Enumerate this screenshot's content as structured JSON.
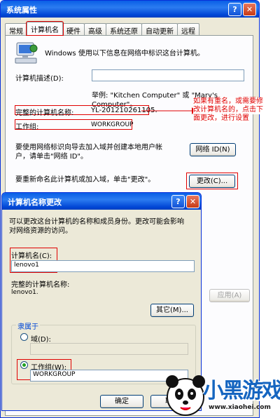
{
  "main_dialog": {
    "title": "系统属性",
    "title_help": "?",
    "title_close": "✕",
    "tabs": [
      "常规",
      "计算机名",
      "硬件",
      "高级",
      "系统还原",
      "自动更新",
      "远程"
    ],
    "intro": "Windows 使用以下信息在网络中标识这台计算机。",
    "desc_label": "计算机描述(D):",
    "desc_value": "",
    "example_line1": "举例: \"Kitchen Computer\" 或 \"Mary's",
    "example_line2": "Computer\"。",
    "full_name_label": "完整的计算机名称:",
    "full_name_value": "YL-201210261105.",
    "workgroup_label": "工作组:",
    "workgroup_value": "WORKGROUP",
    "network_text_line1": "要使用网络标识向导去加入域并创建本地用户帐",
    "network_text_line2": "户，请单击\"网络 ID\"。",
    "network_id_button": "网络 ID(N)",
    "rename_text": "要重新命名此计算机或加入域，单击\"更改\"。",
    "change_button": "更改(C)...",
    "apply_button": "应用(A)"
  },
  "annotation": {
    "line1": "如果有重名，或需要修",
    "line2": "改计算机名的，点击下",
    "line3": "面更改，进行设置"
  },
  "sub_dialog": {
    "title": "计算机名称更改",
    "title_help": "?",
    "title_close": "✕",
    "intro_line1": "可以更改这台计算机的名称和成员身份。更改可能会影响",
    "intro_line2": "对网络资源的访问。",
    "name_label": "计算机名(C):",
    "name_value": "lenovo1",
    "full_name_label": "完整的计算机名称:",
    "full_name_value": "lenovo1.",
    "other_button": "其它(M)...",
    "member_of_label": "隶属于",
    "domain_label": "域(D):",
    "domain_value": "",
    "workgroup_label": "工作组(W):",
    "workgroup_value": "WORKGROUP",
    "ok_button": "确定",
    "cancel_button": "取消"
  },
  "watermark": {
    "brand": "小黑游戏",
    "url": "www.xiaohei.com"
  }
}
